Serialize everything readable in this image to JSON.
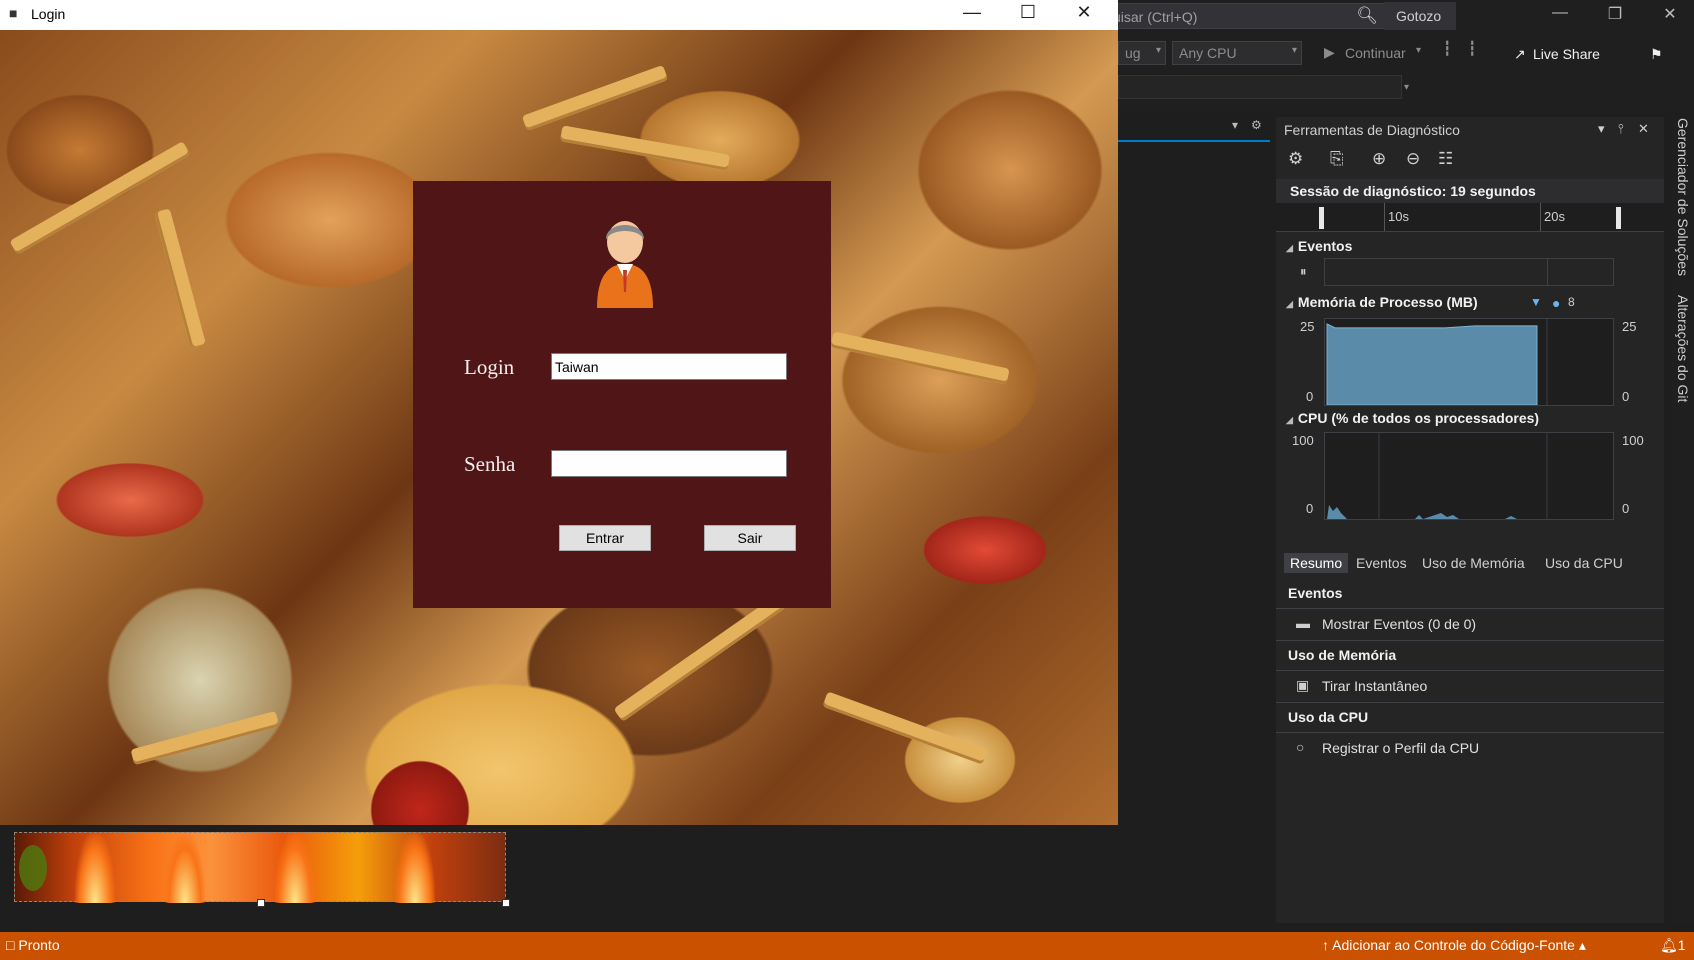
{
  "login_window": {
    "title": "Login",
    "labels": {
      "login": "Login",
      "senha": "Senha"
    },
    "fields": {
      "login_value": "Taiwan",
      "senha_value": ""
    },
    "buttons": {
      "entrar": "Entrar",
      "sair": "Sair"
    }
  },
  "vs": {
    "search_placeholder": "uisar (Ctrl+Q)",
    "solution_name": "Gotozo",
    "toolbar": {
      "config_partial": "ug",
      "platform": "Any CPU",
      "continue_label": "Continuar",
      "live_share": "Live Share"
    }
  },
  "diagnostics": {
    "panel_title": "Ferramentas de Diagnóstico",
    "session": "Sessão de diagnóstico: 19 segundos",
    "ruler": [
      "10s",
      "20s"
    ],
    "events_section": "Eventos",
    "memory": {
      "title": "Memória de Processo (MB)",
      "legend_value": "8",
      "y_max": "25",
      "y_min": "0",
      "level_fraction": 0.92
    },
    "cpu": {
      "title": "CPU (% de todos os processadores)",
      "y_max": "100",
      "y_min": "0"
    },
    "tabs": [
      "Resumo",
      "Eventos",
      "Uso de Memória",
      "Uso da CPU"
    ],
    "summary": {
      "events_header": "Eventos",
      "events_item": "Mostrar Eventos (0 de 0)",
      "memory_header": "Uso de Memória",
      "memory_item": "Tirar Instantâneo",
      "cpu_header": "Uso da CPU",
      "cpu_item": "Registrar o Perfil da CPU"
    }
  },
  "side_tabs": [
    "Gerenciador de Soluções",
    "Alterações do Git"
  ],
  "status_bar": {
    "left": "Pronto",
    "right": "Adicionar ao Controle do Código-Fonte",
    "badge": "1"
  }
}
